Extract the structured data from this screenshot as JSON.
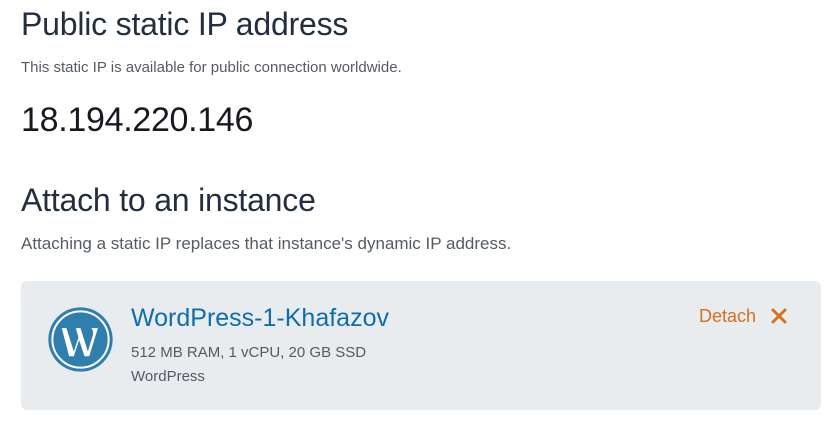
{
  "public_ip": {
    "heading": "Public static IP address",
    "description": "This static IP is available for public connection worldwide.",
    "address": "18.194.220.146"
  },
  "attach": {
    "heading": "Attach to an instance",
    "description": "Attaching a static IP replaces that instance's dynamic IP address."
  },
  "instance": {
    "name": "WordPress-1-Khafazov",
    "spec": "512 MB RAM, 1 vCPU, 20 GB SSD",
    "blueprint": "WordPress",
    "icon": "wordpress-logo-icon",
    "detach_label": "Detach",
    "detach_icon": "close-icon"
  },
  "colors": {
    "link": "#0f6ea8",
    "accent_orange": "#d4711b",
    "card_background": "#e9ecef",
    "wordpress_blue": "#2f7eae"
  }
}
